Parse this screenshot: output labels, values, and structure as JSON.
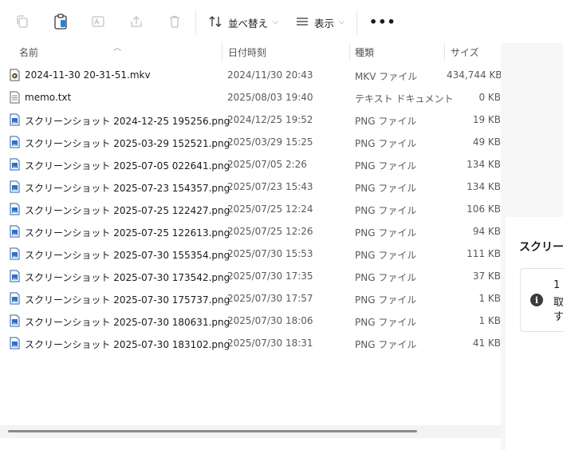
{
  "toolbar": {
    "sort_label": "並べ替え",
    "view_label": "表示",
    "more_label": "•••"
  },
  "columns": {
    "name": "名前",
    "date": "日付時刻",
    "type": "種類",
    "size": "サイズ"
  },
  "files": [
    {
      "name": "2024-11-30 20-31-51.mkv",
      "date": "2024/11/30 20:43",
      "type": "MKV ファイル",
      "size": "434,744 KB",
      "icon": "video-file-icon"
    },
    {
      "name": "memo.txt",
      "date": "2025/08/03 19:40",
      "type": "テキスト ドキュメント",
      "size": "0 KB",
      "icon": "text-file-icon"
    },
    {
      "name": "スクリーンショット 2024-12-25 195256.png",
      "date": "2024/12/25 19:52",
      "type": "PNG ファイル",
      "size": "19 KB",
      "icon": "image-file-icon"
    },
    {
      "name": "スクリーンショット 2025-03-29 152521.png",
      "date": "2025/03/29 15:25",
      "type": "PNG ファイル",
      "size": "49 KB",
      "icon": "image-file-icon"
    },
    {
      "name": "スクリーンショット 2025-07-05 022641.png",
      "date": "2025/07/05 2:26",
      "type": "PNG ファイル",
      "size": "134 KB",
      "icon": "image-file-icon"
    },
    {
      "name": "スクリーンショット 2025-07-23 154357.png",
      "date": "2025/07/23 15:43",
      "type": "PNG ファイル",
      "size": "134 KB",
      "icon": "image-file-icon"
    },
    {
      "name": "スクリーンショット 2025-07-25 122427.png",
      "date": "2025/07/25 12:24",
      "type": "PNG ファイル",
      "size": "106 KB",
      "icon": "image-file-icon"
    },
    {
      "name": "スクリーンショット 2025-07-25 122613.png",
      "date": "2025/07/25 12:26",
      "type": "PNG ファイル",
      "size": "94 KB",
      "icon": "image-file-icon"
    },
    {
      "name": "スクリーンショット 2025-07-30 155354.png",
      "date": "2025/07/30 15:53",
      "type": "PNG ファイル",
      "size": "111 KB",
      "icon": "image-file-icon"
    },
    {
      "name": "スクリーンショット 2025-07-30 173542.png",
      "date": "2025/07/30 17:35",
      "type": "PNG ファイル",
      "size": "37 KB",
      "icon": "image-file-icon"
    },
    {
      "name": "スクリーンショット 2025-07-30 175737.png",
      "date": "2025/07/30 17:57",
      "type": "PNG ファイル",
      "size": "1 KB",
      "icon": "image-file-icon"
    },
    {
      "name": "スクリーンショット 2025-07-30 180631.png",
      "date": "2025/07/30 18:06",
      "type": "PNG ファイル",
      "size": "1 KB",
      "icon": "image-file-icon"
    },
    {
      "name": "スクリーンショット 2025-07-30 183102.png",
      "date": "2025/07/30 18:31",
      "type": "PNG ファイル",
      "size": "41 KB",
      "icon": "image-file-icon"
    }
  ],
  "details": {
    "title": "スクリーン",
    "info_lines": [
      "1",
      "取",
      "す"
    ]
  }
}
